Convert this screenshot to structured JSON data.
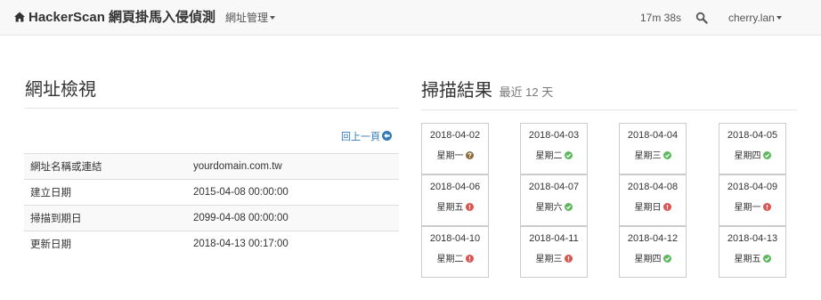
{
  "navbar": {
    "brand": "HackerScan 網頁掛馬入侵偵測",
    "url_menu": "網址管理",
    "timer": "17m 38s",
    "user": "cherry.lan"
  },
  "left_panel": {
    "title": "網址檢視",
    "back_link": "回上一頁",
    "rows": [
      {
        "key": "網址名稱或連結",
        "value": "yourdomain.com.tw"
      },
      {
        "key": "建立日期",
        "value": "2015-04-08 00:00:00"
      },
      {
        "key": "掃描到期日",
        "value": "2099-04-08 00:00:00"
      },
      {
        "key": "更新日期",
        "value": "2018-04-13 00:17:00"
      }
    ]
  },
  "right_panel": {
    "title": "掃描結果",
    "subtitle": "最近 12 天",
    "results": [
      {
        "date": "2018-04-02",
        "weekday": "星期一",
        "status": "unknown"
      },
      {
        "date": "2018-04-03",
        "weekday": "星期二",
        "status": "ok"
      },
      {
        "date": "2018-04-04",
        "weekday": "星期三",
        "status": "ok"
      },
      {
        "date": "2018-04-05",
        "weekday": "星期四",
        "status": "ok"
      },
      {
        "date": "2018-04-06",
        "weekday": "星期五",
        "status": "alert"
      },
      {
        "date": "2018-04-07",
        "weekday": "星期六",
        "status": "ok"
      },
      {
        "date": "2018-04-08",
        "weekday": "星期日",
        "status": "alert"
      },
      {
        "date": "2018-04-09",
        "weekday": "星期一",
        "status": "alert"
      },
      {
        "date": "2018-04-10",
        "weekday": "星期二",
        "status": "alert"
      },
      {
        "date": "2018-04-11",
        "weekday": "星期三",
        "status": "alert"
      },
      {
        "date": "2018-04-12",
        "weekday": "星期四",
        "status": "ok"
      },
      {
        "date": "2018-04-13",
        "weekday": "星期五",
        "status": "ok"
      }
    ],
    "status_colors": {
      "ok": "#5cb85c",
      "alert": "#d9534f",
      "unknown": "#8a6d3b"
    }
  }
}
